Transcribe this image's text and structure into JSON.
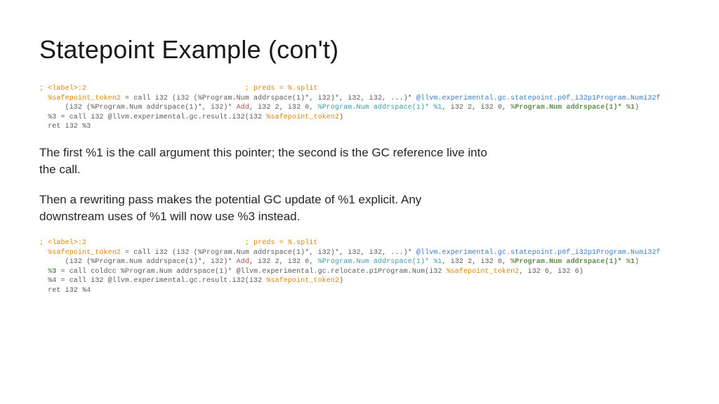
{
  "slide": {
    "title": "Statepoint Example (con't)",
    "code1": {
      "l1a": "; <label>:2",
      "l1b": "; preds = %.split",
      "l2a": "%safepoint_token2",
      "l2b": " = call i32 (i32 (%Program.Num addrspace(1)*, i32)*, i32, i32, ...)* ",
      "l2c": "@llvm.experimental.gc.statepoint.p0f_i32p1Program.Numi32f",
      "l3a": "      (i32 (%Program.Num addrspace(1)*, i32)* ",
      "l3b": "Add",
      "l3c": ", i32 2, i32 0, ",
      "l3d": "%Program.Num addrspace(1)* %1",
      "l3e": ", i32 2, i32 0, ",
      "l3f": "%Program.Num addrspace(1)* %1",
      "l3g": ")",
      "l4a": "  %3 = call i32 @llvm.experimental.gc.result.i32(i32 ",
      "l4b": "%safepoint_token2",
      "l4c": ")",
      "l5": "  ret i32 %3"
    },
    "para1": "The first %1 is the call argument this pointer; the second is the GC reference live into the call.",
    "para2": "Then a rewriting pass makes the potential GC update of %1 explicit. Any downstream uses of %1 will now use %3 instead.",
    "code2": {
      "l1a": "; <label>:2",
      "l1b": "; preds = %.split",
      "l2a": "%safepoint_token2",
      "l2b": " = call i32 (i32 (%Program.Num addrspace(1)*, i32)*, i32, i32, ...)* ",
      "l2c": "@llvm.experimental.gc.statepoint.p0f_i32p1Program.Numi32f",
      "l3a": "      (i32 (%Program.Num addrspace(1)*, i32)* ",
      "l3b": "Add",
      "l3c": ", i32 2, i32 0, ",
      "l3d": "%Program.Num addrspace(1)* %1",
      "l3e": ", i32 2, i32 0, ",
      "l3f": "%Program.Num addrspace(1)* %1",
      "l3g": ")",
      "l4a": "%3",
      "l4b": " = call coldcc %Program.Num addrspace(1)* @llvm.experimental.gc.relocate.p1Program.Num(i32 ",
      "l4c": "%safepoint_token2",
      "l4d": ", i32 6, i32 6)",
      "l5a": "  %4 = call i32 @llvm.experimental.gc.result.i32(i32 ",
      "l5b": "%safepoint_token2",
      "l5c": ")",
      "l6": "  ret i32 %4"
    }
  }
}
